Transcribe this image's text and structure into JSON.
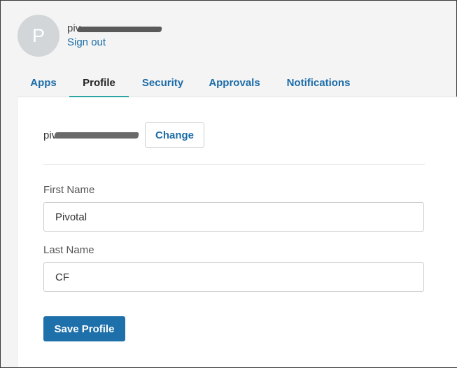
{
  "header": {
    "avatar_initial": "P",
    "email_visible_prefix": "piv",
    "sign_out_label": "Sign out"
  },
  "tabs": [
    {
      "label": "Apps"
    },
    {
      "label": "Profile",
      "active": true
    },
    {
      "label": "Security"
    },
    {
      "label": "Approvals"
    },
    {
      "label": "Notifications"
    }
  ],
  "profile": {
    "email_visible_prefix": "piv",
    "change_label": "Change",
    "first_name_label": "First Name",
    "first_name_value": "Pivotal",
    "last_name_label": "Last Name",
    "last_name_value": "CF",
    "save_label": "Save Profile"
  },
  "colors": {
    "link": "#1c6ca8",
    "active_tab_underline": "#2aa6a2",
    "primary_button": "#1e70ab",
    "avatar_bg": "#d2d6d8"
  }
}
